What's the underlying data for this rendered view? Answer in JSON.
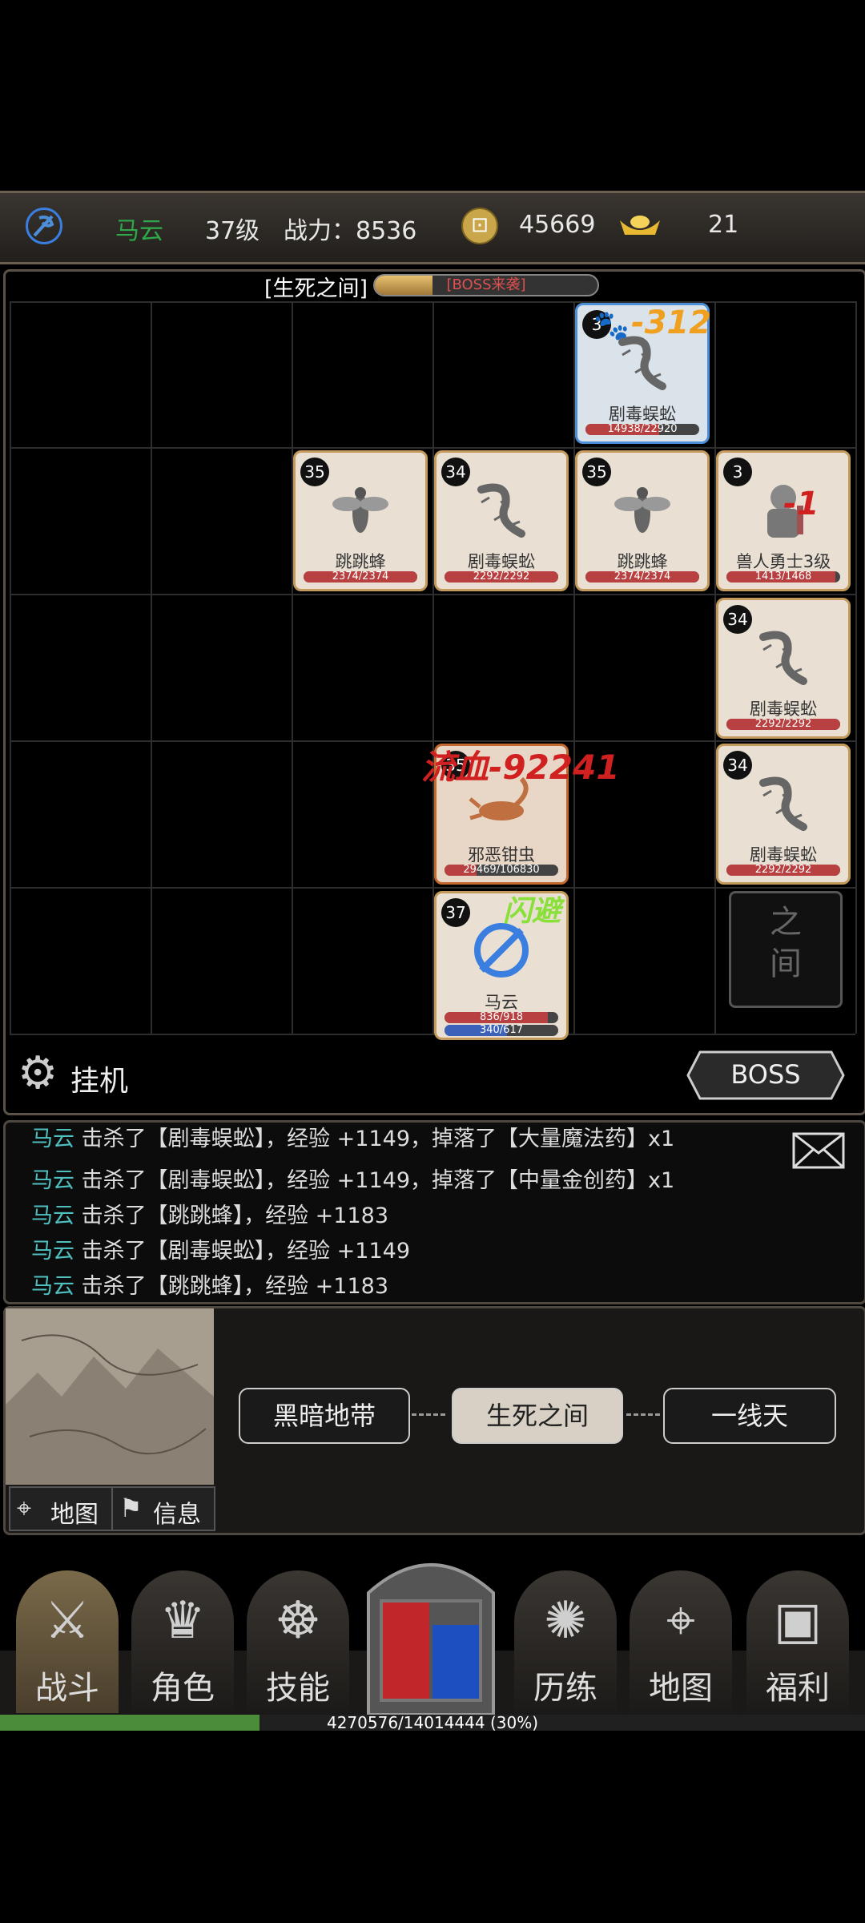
{
  "topbar": {
    "player_name": "马云",
    "level": "37级",
    "power": "战力：8536",
    "coins": "45669",
    "ingots": "21",
    "colors": {
      "name": "#2ea84a"
    }
  },
  "battle": {
    "zone_title": "[生死之间]",
    "boss_label": "[BOSS来袭]",
    "boss_progress": 0.26,
    "cards": [
      {
        "level": "3",
        "name": "剧毒蜈蚣",
        "hp": "14938/22920",
        "hp_frac": 0.65,
        "style": "blue",
        "icon": "centipede-icon",
        "damage": "-312",
        "damage_color": "#f0a020",
        "paw": true
      },
      {
        "level": "35",
        "name": "跳跳蜂",
        "hp": "2374/2374",
        "hp_frac": 1,
        "icon": "bee-icon"
      },
      {
        "level": "34",
        "name": "剧毒蜈蚣",
        "hp": "2292/2292",
        "hp_frac": 1,
        "icon": "centipede-icon"
      },
      {
        "level": "35",
        "name": "跳跳蜂",
        "hp": "2374/2374",
        "hp_frac": 1,
        "icon": "bee-icon"
      },
      {
        "level": "3",
        "name": "兽人勇士3级",
        "hp": "1413/1468",
        "hp_frac": 0.96,
        "icon": "orc-icon",
        "damage": "-1",
        "damage_color": "#d02020"
      },
      {
        "level": "34",
        "name": "剧毒蜈蚣",
        "hp": "2292/2292",
        "hp_frac": 1,
        "icon": "centipede-icon"
      },
      {
        "level": "35",
        "name": "邪恶钳虫",
        "hp": "29469/106830",
        "hp_frac": 0.28,
        "icon": "scorpion-icon",
        "damage": "流血-92241",
        "damage_color": "#d02020"
      },
      {
        "level": "34",
        "name": "剧毒蜈蚣",
        "hp": "2292/2292",
        "hp_frac": 1,
        "icon": "centipede-icon"
      },
      {
        "level": "37",
        "name": "马云",
        "hp": "836/918",
        "hp_frac": 0.91,
        "mp": "340/617",
        "mp_frac": 0.55,
        "icon": "player-emblem-icon",
        "damage": "闪避",
        "damage_color": "#8ae03a"
      }
    ],
    "portal_text": "之间",
    "idle_label": "挂机",
    "boss_button": "BOSS"
  },
  "log": {
    "lines": [
      {
        "who": "马云",
        "text": "击杀了【剧毒蜈蚣】，经验 +1149，掉落了【大量魔法药】x1"
      },
      {
        "who": "马云",
        "text": "击杀了【剧毒蜈蚣】，经验 +1149，掉落了【中量金创药】x1"
      },
      {
        "who": "马云",
        "text": "击杀了【跳跳蜂】，经验 +1183"
      },
      {
        "who": "马云",
        "text": "击杀了【剧毒蜈蚣】，经验 +1149"
      },
      {
        "who": "马云",
        "text": "击杀了【跳跳蜂】，经验 +1183"
      }
    ]
  },
  "map": {
    "map_label": "地图",
    "info_label": "信息",
    "prev": "黑暗地带",
    "current": "生死之间",
    "next": "一线天"
  },
  "nav": {
    "items": [
      "战斗",
      "角色",
      "技能",
      "历练",
      "地图",
      "福利"
    ]
  },
  "exp": {
    "text": "4270576/14014444 (30%)",
    "fraction": 0.3
  }
}
